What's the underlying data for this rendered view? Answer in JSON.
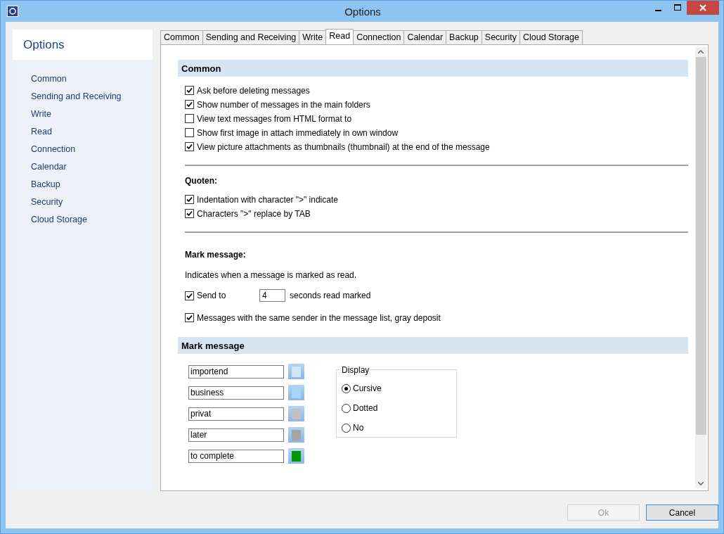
{
  "window": {
    "title": "Options"
  },
  "sidebar": {
    "title": "Options",
    "items": [
      {
        "label": "Common"
      },
      {
        "label": "Sending and Receiving"
      },
      {
        "label": "Write"
      },
      {
        "label": "Read"
      },
      {
        "label": "Connection"
      },
      {
        "label": "Calendar"
      },
      {
        "label": "Backup"
      },
      {
        "label": "Security"
      },
      {
        "label": "Cloud Storage"
      }
    ]
  },
  "tabs": [
    {
      "label": "Common",
      "selected": false
    },
    {
      "label": "Sending and Receiving",
      "selected": false
    },
    {
      "label": "Write",
      "selected": false
    },
    {
      "label": "Read",
      "selected": true
    },
    {
      "label": "Connection",
      "selected": false
    },
    {
      "label": "Calendar",
      "selected": false
    },
    {
      "label": "Backup",
      "selected": false
    },
    {
      "label": "Security",
      "selected": false
    },
    {
      "label": "Cloud Storage",
      "selected": false
    }
  ],
  "common": {
    "title": "Common",
    "options": [
      {
        "label": "Ask before deleting messages",
        "checked": true
      },
      {
        "label": "Show number of messages in the main folders",
        "checked": true
      },
      {
        "label": "View text messages from HTML format to",
        "checked": false
      },
      {
        "label": "Show first image in attach immediately in own window",
        "checked": false
      },
      {
        "label": "View picture attachments as thumbnails (thumbnail) at the end of the message",
        "checked": true
      }
    ]
  },
  "quoten": {
    "title": "Quoten:",
    "options": [
      {
        "label": "Indentation with character \">\" indicate",
        "checked": true
      },
      {
        "label": "Characters \">\" replace by TAB",
        "checked": true
      }
    ]
  },
  "mark": {
    "title": "Mark message:",
    "description": "Indicates when a message is marked as read.",
    "send_to": {
      "label": "Send to",
      "checked": true,
      "value": "4",
      "suffix": "seconds read marked"
    },
    "gray": {
      "label": "Messages with the same sender in the message list, gray deposit",
      "checked": true
    }
  },
  "mark_colors": {
    "title": "Mark message",
    "items": [
      {
        "value": "importend",
        "color": "#cfe6fb"
      },
      {
        "value": "business",
        "color": "#aad4f8"
      },
      {
        "value": "privat",
        "color": "#c0c0c0"
      },
      {
        "value": "later",
        "color": "#a5a5a5"
      },
      {
        "value": "to complete",
        "color": "#009900"
      }
    ],
    "display": {
      "title": "Display",
      "options": [
        {
          "label": "Cursive",
          "selected": true
        },
        {
          "label": "Dotted",
          "selected": false
        },
        {
          "label": "No",
          "selected": false
        }
      ]
    }
  },
  "buttons": [
    {
      "label": "Ok",
      "disabled": true
    },
    {
      "label": "Cancel",
      "disabled": false
    }
  ]
}
